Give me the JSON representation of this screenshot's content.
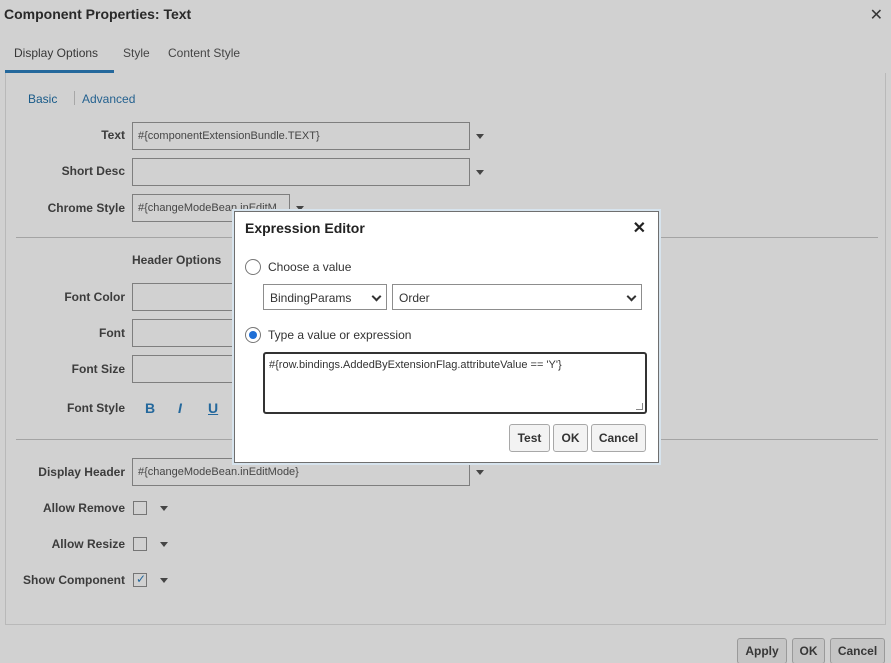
{
  "dialog": {
    "title": "Component Properties: Text",
    "close_glyph": "✕",
    "tabs": [
      "Display Options",
      "Style",
      "Content Style"
    ],
    "subtabs": [
      "Basic",
      "Advanced"
    ]
  },
  "form": {
    "text_label": "Text",
    "text_value": "#{componentExtensionBundle.TEXT}",
    "short_desc_label": "Short Desc",
    "short_desc_value": "",
    "chrome_style_label": "Chrome Style",
    "chrome_style_value": "#{changeModeBean.inEditM",
    "header_options_title": "Header Options",
    "font_color_label": "Font Color",
    "font_label": "Font",
    "font_size_label": "Font Size",
    "font_style_label": "Font Style",
    "bold_glyph": "B",
    "italic_glyph": "I",
    "underline_glyph": "U",
    "display_header_label": "Display Header",
    "display_header_value": "#{changeModeBean.inEditMode}",
    "allow_remove_label": "Allow Remove",
    "allow_remove_checked": false,
    "allow_resize_label": "Allow Resize",
    "allow_resize_checked": false,
    "show_component_label": "Show Component",
    "show_component_checked": true,
    "check_glyph": "✓"
  },
  "footer": {
    "apply_label": "Apply",
    "ok_label": "OK",
    "cancel_label": "Cancel"
  },
  "expression_editor": {
    "title": "Expression Editor",
    "close_glyph": "✕",
    "choose_value_label": "Choose a value",
    "choose_value_selected": false,
    "select1_value": "BindingParams",
    "select2_value": "Order",
    "type_expression_label": "Type a value or expression",
    "type_expression_selected": true,
    "expression_value": "#{row.bindings.AddedByExtensionFlag.attributeValue == 'Y'}",
    "test_label": "Test",
    "ok_label": "OK",
    "cancel_label": "Cancel"
  },
  "colors": {
    "accent": "#2d7fbf",
    "radio_on": "#1f6fd6"
  }
}
